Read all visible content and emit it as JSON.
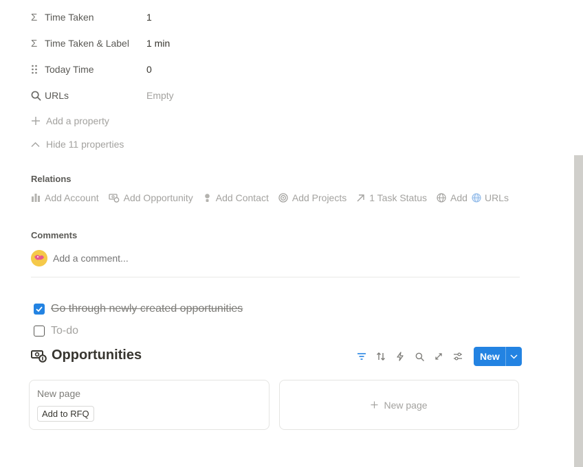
{
  "properties": [
    {
      "icon": "sigma-icon",
      "name": "Time Taken",
      "value": "1",
      "empty": false
    },
    {
      "icon": "sigma-icon",
      "name": "Time Taken & Label",
      "value": "1 min",
      "empty": false
    },
    {
      "icon": "drag-dots-icon",
      "name": "Today Time",
      "value": "0",
      "empty": false
    },
    {
      "icon": "search-icon",
      "name": "URLs",
      "value": "Empty",
      "empty": true
    }
  ],
  "add_property_label": "Add a property",
  "hide_properties_label": "Hide 11 properties",
  "relations": {
    "title": "Relations",
    "items": [
      {
        "icon": "account-icon",
        "label": "Add Account"
      },
      {
        "icon": "opportunity-icon",
        "label": "Add Opportunity"
      },
      {
        "icon": "contact-icon",
        "label": "Add Contact"
      },
      {
        "icon": "target-icon",
        "label": "Add Projects"
      },
      {
        "icon": "arrow-up-right-icon",
        "label": "1 Task Status"
      },
      {
        "icon": "globe-icon",
        "label": "Add",
        "suffix_icon": "globe-icon",
        "suffix": "URLs"
      }
    ]
  },
  "comments": {
    "title": "Comments",
    "placeholder": "Add a comment..."
  },
  "todos": [
    {
      "checked": true,
      "text": "Go through newly created opportunities"
    },
    {
      "checked": false,
      "text": "To-do"
    }
  ],
  "database": {
    "title": "Opportunities",
    "new_button": "New",
    "cards": [
      {
        "title": "New page",
        "tag": "Add to RFQ"
      }
    ],
    "new_page_label": "New page"
  },
  "colors": {
    "accent": "#2383e2",
    "muted": "#a3a29f",
    "text": "#37352f"
  }
}
